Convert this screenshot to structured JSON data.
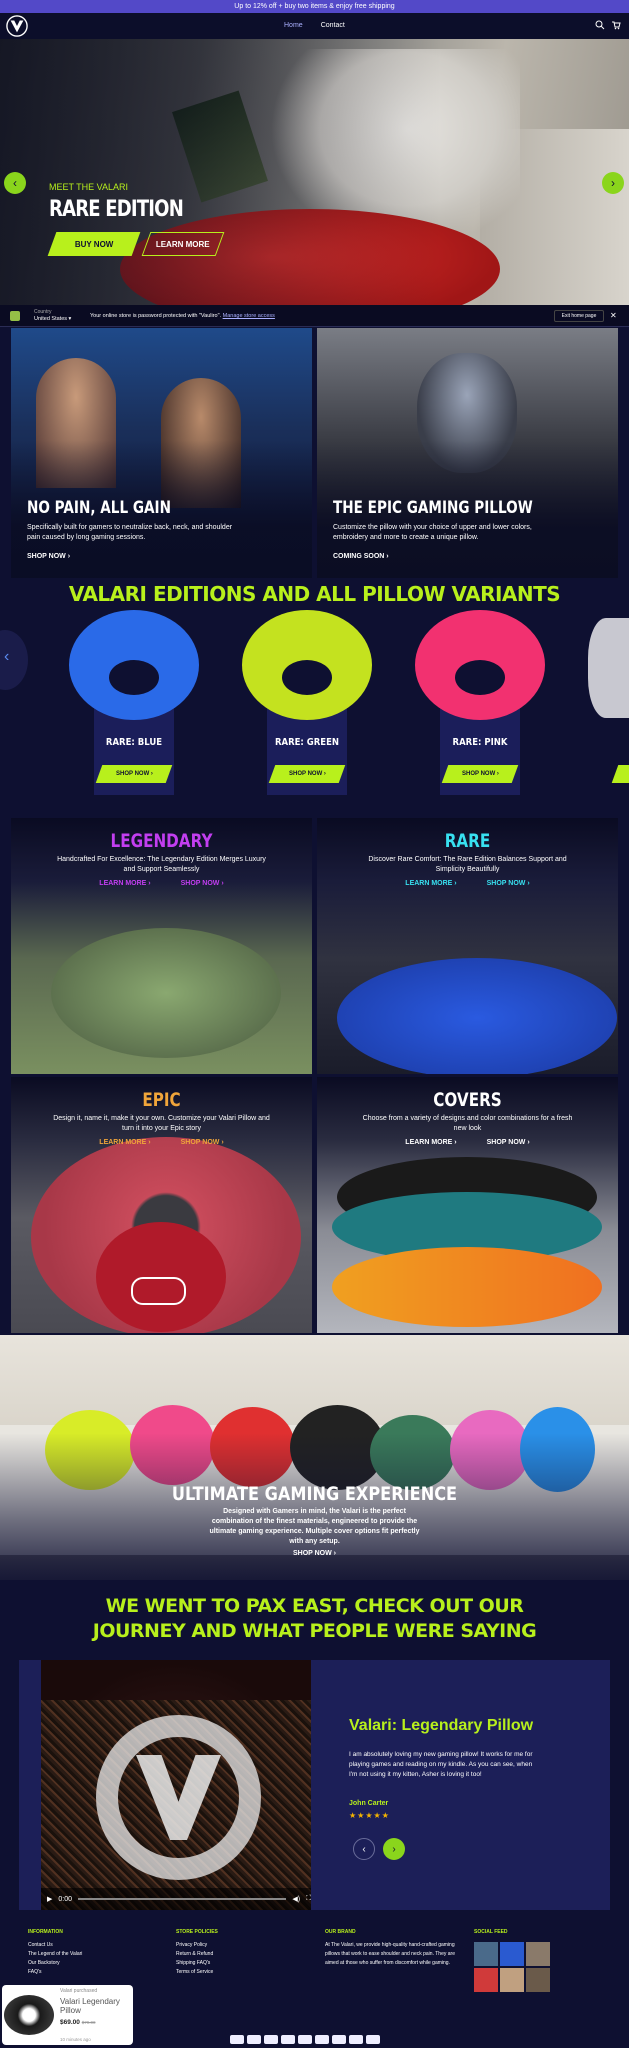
{
  "announcement": "Up to 12% off + buy two items & enjoy free shipping",
  "header": {
    "nav": [
      "Home",
      "Contact"
    ]
  },
  "hero": {
    "kicker": "MEET THE VALARI",
    "title": "RARE EDITION",
    "buy": "BUY NOW",
    "learn": "LEARN MORE",
    "prev": "‹",
    "next": "›"
  },
  "password_bar": {
    "country_label": "Country",
    "country_value": "United States ▾",
    "message": "Your online store is password protected with \"Vauliro\". ",
    "link": "Manage store access",
    "exit": "Exit home page",
    "close": "✕"
  },
  "promo": [
    {
      "title": "NO PAIN, ALL GAIN",
      "body": "Specifically built for gamers to neutralize back, neck, and shoulder pain caused by long gaming sessions.",
      "cta": "SHOP NOW ›"
    },
    {
      "title": "THE EPIC GAMING PILLOW",
      "body": "Customize the pillow with your choice of upper and lower colors, embroidery and more to create a unique pillow.",
      "cta": "COMING SOON ›"
    }
  ],
  "variants_title": "VALARI EDITIONS AND ALL PILLOW VARIANTS",
  "variants": [
    {
      "label": "RARE: BLUE",
      "shop": "SHOP NOW ›",
      "color": "#2a6ae8"
    },
    {
      "label": "RARE: GREEN",
      "shop": "SHOP NOW ›",
      "color": "#c4e21f"
    },
    {
      "label": "RARE: PINK",
      "shop": "SHOP NOW ›",
      "color": "#f23170"
    }
  ],
  "editions": [
    {
      "title": "LEGENDARY",
      "color": "#c23ef0",
      "body": "Handcrafted For Excellence: The Legendary Edition Merges Luxury and Support Seamlessly",
      "learn": "LEARN MORE ›",
      "shop": "SHOP NOW ›",
      "linkcolor": "#c23ef0"
    },
    {
      "title": "RARE",
      "color": "#38e0f0",
      "body": "Discover Rare Comfort: The Rare Edition Balances Support and Simplicity Beautifully",
      "learn": "LEARN MORE ›",
      "shop": "SHOP NOW ›",
      "linkcolor": "#38e0f0"
    },
    {
      "title": "EPIC",
      "color": "#f0a53a",
      "body": "Design it, name it, make it your own. Customize your Valari Pillow and turn it into your Epic story",
      "learn": "LEARN MORE ›",
      "shop": "SHOP NOW ›",
      "linkcolor": "#f0a53a"
    },
    {
      "title": "COVERS",
      "color": "#ffffff",
      "body": "Choose from a variety of designs and color combinations for a fresh new look",
      "learn": "LEARN MORE ›",
      "shop": "SHOP NOW ›",
      "linkcolor": "#ffffff"
    }
  ],
  "experience": {
    "title": "ULTIMATE GAMING EXPERIENCE",
    "body": "Designed with Gamers in mind, the Valari is the perfect combination of the finest materials, engineered to provide the ultimate gaming experience. Multiple cover options fit perfectly with any setup.",
    "cta": "SHOP NOW ›"
  },
  "pax_title_1": "WE WENT TO PAX EAST, CHECK OUT OUR",
  "pax_title_2": "JOURNEY AND WHAT PEOPLE WERE SAYING",
  "testimonial": {
    "product": "Valari: Legendary Pillow",
    "body": "I am absolutely loving my new gaming pillow! It works for me for playing games and reading on my kindle. As you can see, when I'm not using it my kitten, Asher is loving it too!",
    "author": "John Carter",
    "stars": "★★★★★",
    "prev": "‹",
    "next": "›",
    "time": "0:00"
  },
  "footer": {
    "info_h": "INFORMATION",
    "info": [
      "Contact Us",
      "The Legend of the Valari",
      "Our Backstory",
      "FAQ's"
    ],
    "policy_h": "STORE POLICIES",
    "policy": [
      "Privacy Policy",
      "Return & Refund",
      "Shipping FAQ's",
      "Terms of Service"
    ],
    "brand_h": "OUR BRAND",
    "brand": "At The Valari, we provide high-quality hand-crafted gaming pillows that work to ease shoulder and neck pain. They are aimed at those who suffer from discomfort while gaming.",
    "social_h": "SOCIAL FEED"
  },
  "popup": {
    "tag": "Valari purchased",
    "name": "Valari Legendary Pillow",
    "price": "$69.00",
    "old": "$79.00",
    "ago": "10 minutes ago"
  }
}
